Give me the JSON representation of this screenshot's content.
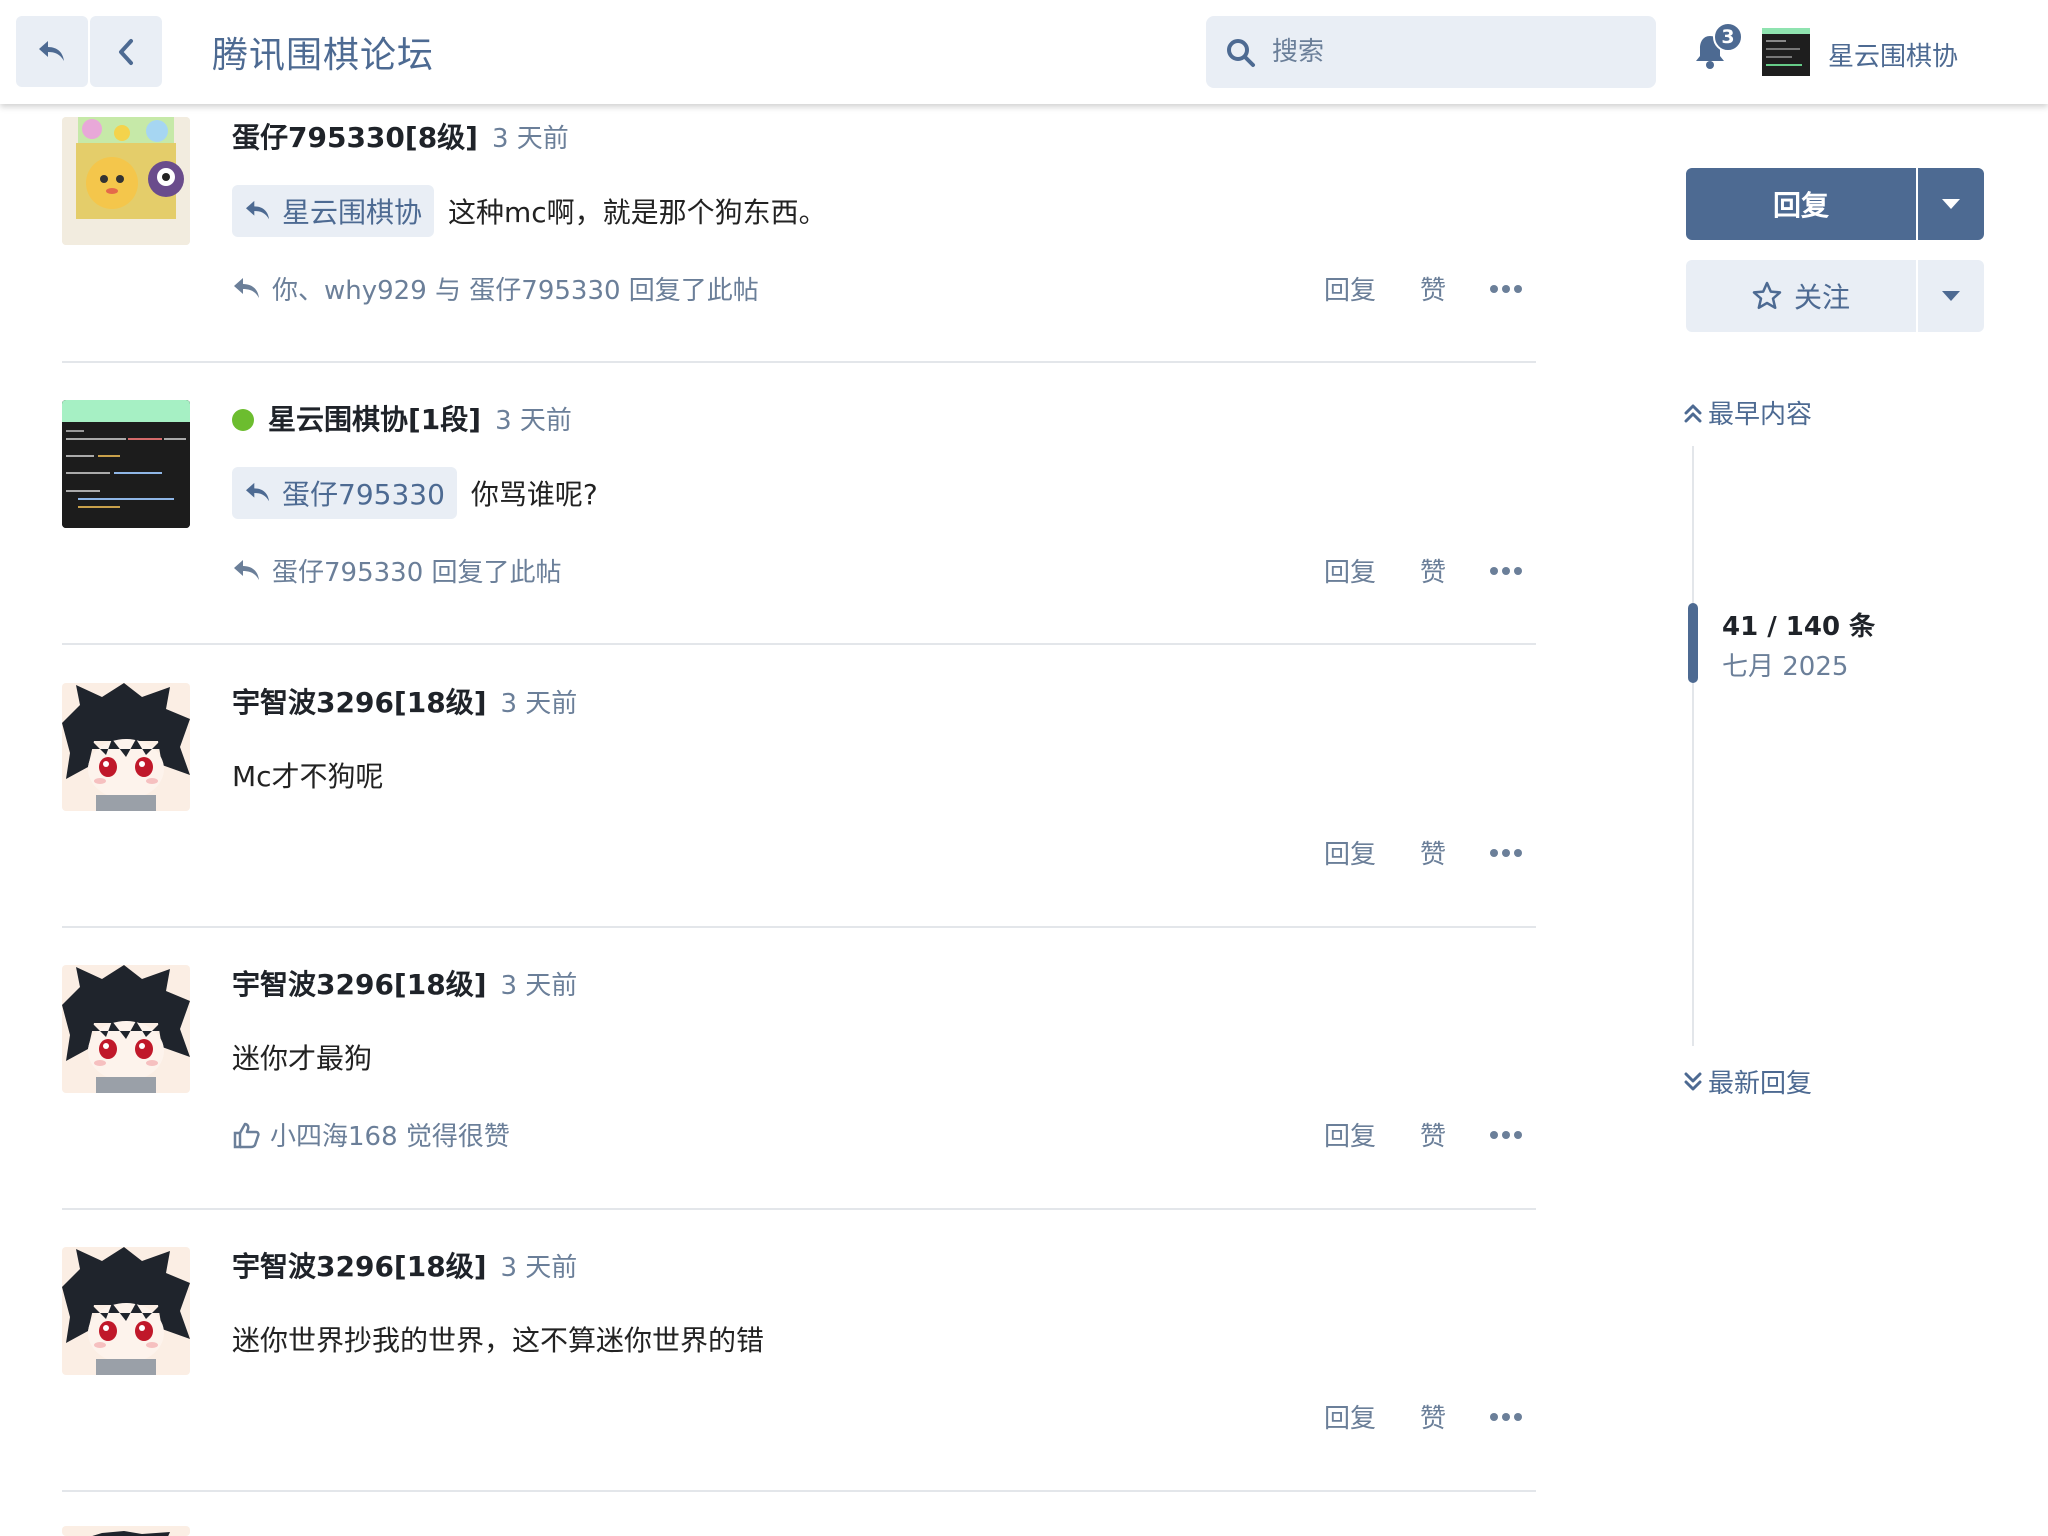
{
  "header": {
    "site_title": "腾讯围棋论坛",
    "search_placeholder": "搜索",
    "notification_count": "3",
    "current_user": "星云围棋协"
  },
  "posts": [
    {
      "username": "蛋仔795330[8级]",
      "time": "3 天前",
      "reply_to": "星云围棋协",
      "body": "这种mc啊，就是那个狗东西。",
      "info_icon": "reply-icon",
      "info": "你、why929 与 蛋仔795330 回复了此帖",
      "actions": {
        "reply": "回复",
        "like": "赞"
      }
    },
    {
      "username": "星云围棋协[1段]",
      "time": "3 天前",
      "online": true,
      "reply_to": "蛋仔795330",
      "body": "你骂谁呢?",
      "info_icon": "reply-icon",
      "info": "蛋仔795330 回复了此帖",
      "actions": {
        "reply": "回复",
        "like": "赞"
      }
    },
    {
      "username": "宇智波3296[18级]",
      "time": "3 天前",
      "body": "Mc才不狗呢",
      "actions": {
        "reply": "回复",
        "like": "赞"
      }
    },
    {
      "username": "宇智波3296[18级]",
      "time": "3 天前",
      "body": "迷你才最狗",
      "info_icon": "thumbs-up-icon",
      "info": "小四海168 觉得很赞",
      "actions": {
        "reply": "回复",
        "like": "赞"
      }
    },
    {
      "username": "宇智波3296[18级]",
      "time": "3 天前",
      "body": "迷你世界抄我的世界，这不算迷你世界的错",
      "actions": {
        "reply": "回复",
        "like": "赞"
      }
    }
  ],
  "sidebar": {
    "reply_button": "回复",
    "watch_button": "关注",
    "oldest_link": "最早内容",
    "position": "41 / 140 条",
    "date": "七月 2025",
    "latest_link": "最新回复"
  },
  "colors": {
    "accent": "#4d6a92",
    "muted": "#6b7f99",
    "button_bg": "#e9eef5",
    "online": "#6cbd2f"
  }
}
